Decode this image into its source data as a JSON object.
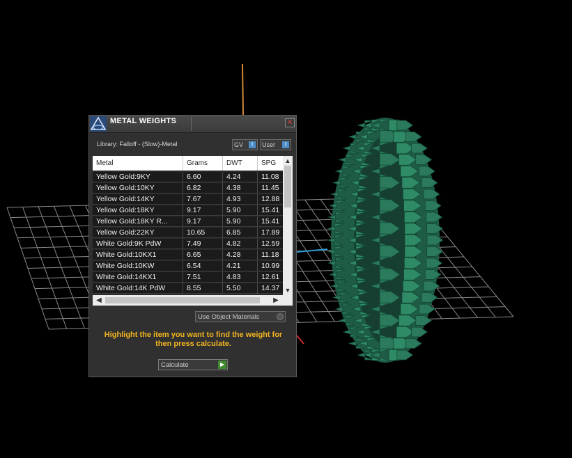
{
  "window": {
    "title": "METAL WEIGHTS",
    "close_glyph": "✕",
    "library_label": "Library: Falloff - (Slow)-Metal",
    "toggle_gv": "GV",
    "toggle_user": "User",
    "toggle_indicator": "I",
    "use_object_materials": "Use Object Materials",
    "hint": "Highlight the item you want to find the weight for then press calculate.",
    "calculate_label": "Calculate"
  },
  "table": {
    "columns": [
      "Metal",
      "Grams",
      "DWT",
      "SPG"
    ],
    "rows": [
      [
        "Yellow Gold:9KY",
        "6.60",
        "4.24",
        "11.08"
      ],
      [
        "Yellow Gold:10KY",
        "6.82",
        "4.38",
        "11.45"
      ],
      [
        "Yellow Gold:14KY",
        "7.67",
        "4.93",
        "12.88"
      ],
      [
        "Yellow Gold:18KY",
        "9.17",
        "5.90",
        "15.41"
      ],
      [
        "Yellow Gold:18KY R...",
        "9.17",
        "5.90",
        "15.41"
      ],
      [
        "Yellow Gold:22KY",
        "10.65",
        "6.85",
        "17.89"
      ],
      [
        "White Gold:9K PdW",
        "7.49",
        "4.82",
        "12.59"
      ],
      [
        "White Gold:10KX1",
        "6.65",
        "4.28",
        "11.18"
      ],
      [
        "White Gold:10KW",
        "6.54",
        "4.21",
        "10.99"
      ],
      [
        "White Gold:14KX1",
        "7.51",
        "4.83",
        "12.61"
      ],
      [
        "White Gold:14K PdW",
        "8.55",
        "5.50",
        "14.37"
      ]
    ]
  },
  "icons": {
    "logo": "triangle-logo-icon",
    "close": "close-icon",
    "scroll_up": "▲",
    "scroll_down": "▼",
    "scroll_left": "◀",
    "scroll_right": "▶",
    "play": "▶"
  },
  "colors": {
    "ring": "#2b7a5c",
    "hint_text": "#f2b520",
    "grid": "#7a7a7a",
    "accent_blue": "#4d8ec9"
  }
}
